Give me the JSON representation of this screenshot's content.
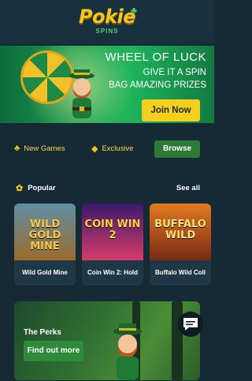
{
  "brand": {
    "name": "Pokie",
    "sub": "SPINS",
    "logo_color": "#f6c51e",
    "accent_green": "#4fd07a"
  },
  "banner": {
    "title": "WHEEL OF LUCK",
    "line1": "GIVE IT A SPIN",
    "line2": "BAG AMAZING PRIZES",
    "cta": "Join Now",
    "cta_color": "#f4cf20",
    "active_dot": 0,
    "dot_count": 4
  },
  "filters": {
    "new_games": "New Games",
    "exclusive": "Exclusive",
    "browse": "Browse"
  },
  "popular": {
    "label": "Popular",
    "see_all": "See all",
    "games": [
      {
        "name": "Wild Gold Mine",
        "art_title": "WILD GOLD MINE",
        "art_colors": [
          "#5e8ea3",
          "#9c6b2c"
        ]
      },
      {
        "name": "Coin Win 2: Hold",
        "art_title": "COIN WIN 2",
        "art_colors": [
          "#3a1a6b",
          "#d83a6a"
        ]
      },
      {
        "name": "Buffalo Wild Coll",
        "art_title": "BUFFALO WILD",
        "art_colors": [
          "#e17a1f",
          "#7a2b18"
        ]
      }
    ]
  },
  "perks": {
    "title": "The Perks",
    "cta": "Find out more"
  },
  "icons": {
    "new_games": "clover-icon",
    "exclusive": "gem-icon",
    "popular": "medal-icon",
    "chat": "chat-icon"
  }
}
